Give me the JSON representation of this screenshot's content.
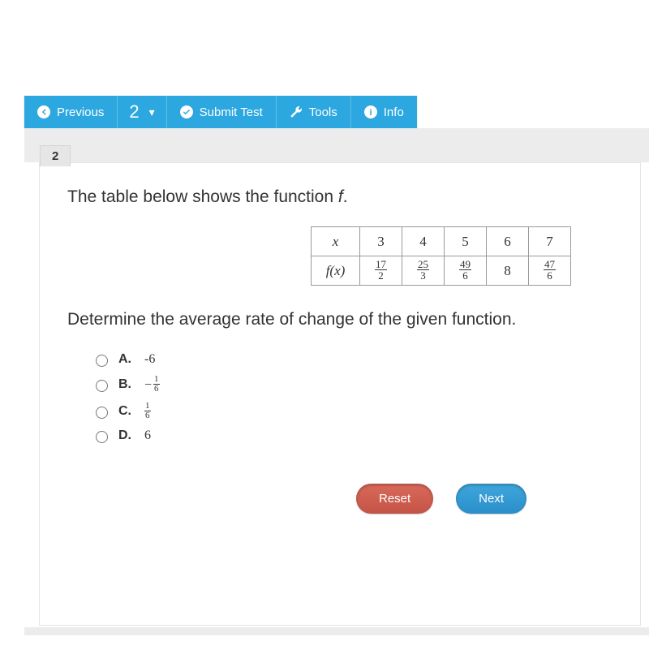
{
  "toolbar": {
    "previous_label": "Previous",
    "question_number": "2",
    "submit_label": "Submit Test",
    "tools_label": "Tools",
    "info_label": "Info"
  },
  "question": {
    "tab_number": "2",
    "prompt_prefix": "The table below shows the function ",
    "prompt_var": "f",
    "prompt_suffix": ".",
    "sub_prompt": "Determine the average rate of change of the given function.",
    "table": {
      "row1_label_html": "x",
      "row2_label_html": "f(x)",
      "x_values": [
        "3",
        "4",
        "5",
        "6",
        "7"
      ],
      "fx_values": [
        {
          "type": "frac",
          "num": "17",
          "den": "2"
        },
        {
          "type": "frac",
          "num": "25",
          "den": "3"
        },
        {
          "type": "frac",
          "num": "49",
          "den": "6"
        },
        {
          "type": "int",
          "value": "8"
        },
        {
          "type": "frac",
          "num": "47",
          "den": "6"
        }
      ]
    },
    "choices": [
      {
        "letter": "A.",
        "display": {
          "type": "int",
          "value": "-6"
        }
      },
      {
        "letter": "B.",
        "display": {
          "type": "negfrac",
          "num": "1",
          "den": "6"
        }
      },
      {
        "letter": "C.",
        "display": {
          "type": "frac",
          "num": "1",
          "den": "6"
        }
      },
      {
        "letter": "D.",
        "display": {
          "type": "int",
          "value": "6"
        }
      }
    ]
  },
  "actions": {
    "reset_label": "Reset",
    "next_label": "Next"
  }
}
